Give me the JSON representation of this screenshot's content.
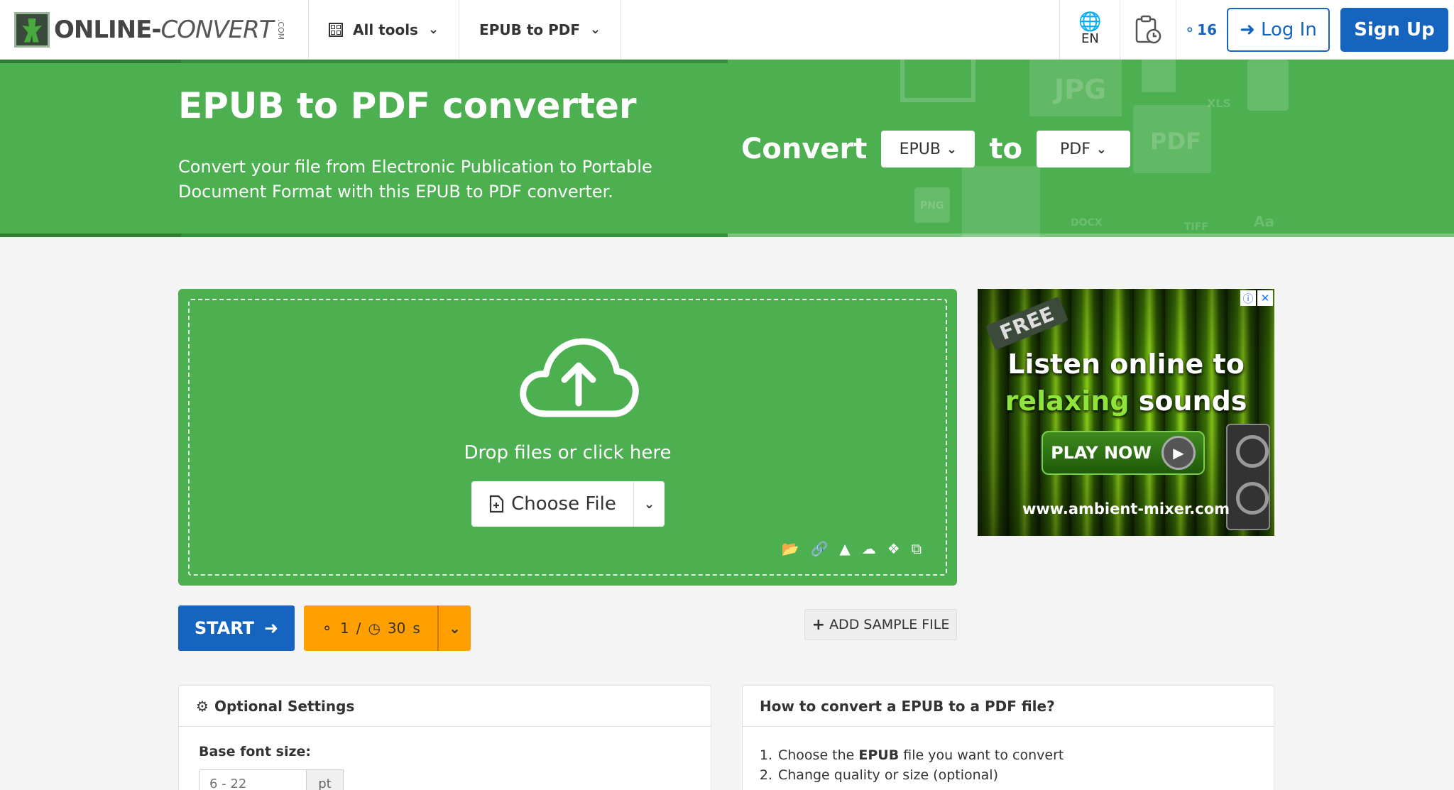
{
  "brand": {
    "name_main": "ONLINE",
    "name_dash": "-",
    "name_rest": "CONVERT",
    "name_tld": ".COM"
  },
  "nav": {
    "all_tools": "All tools",
    "current_tool": "EPUB to PDF",
    "language": "EN",
    "credits": "16",
    "login": "Log In",
    "signup": "Sign Up"
  },
  "hero": {
    "title": "EPUB to PDF converter",
    "description": "Convert your file from Electronic Publication to Portable Document Format with this EPUB to PDF converter.",
    "convert_label": "Convert",
    "from_format": "EPUB",
    "to_label": "to",
    "to_format": "PDF",
    "bg_icons": [
      "JPG",
      "PDF",
      "XLS",
      "PNG",
      "DOCX",
      "TIFF",
      "Aa"
    ]
  },
  "upload": {
    "drop_text": "Drop files or click here",
    "choose_file": "Choose File",
    "source_icons": [
      "folder-icon",
      "link-icon",
      "google-drive-icon",
      "onedrive-icon",
      "dropbox-icon",
      "clipboard-icon"
    ]
  },
  "ad": {
    "badge": "FREE",
    "line1": "Listen online to",
    "line2_green": "relaxing",
    "line2_rest": " sounds",
    "cta": "PLAY NOW",
    "url": "www.ambient-mixer.com",
    "info_glyph": "ⓘ",
    "close_glyph": "✕"
  },
  "actions": {
    "start": "START",
    "quota_credits": "1",
    "quota_sep": "/",
    "quota_time": "30",
    "quota_unit": "s",
    "add_sample": "ADD SAMPLE FILE"
  },
  "settings": {
    "title": "Optional Settings",
    "base_font_label": "Base font size:",
    "base_font_placeholder": "6 - 22",
    "base_font_unit": "pt"
  },
  "howto": {
    "title": "How to convert a EPUB to a PDF file?",
    "step1_pre": "Choose the ",
    "step1_bold": "EPUB",
    "step1_post": " file you want to convert",
    "step2": "Change quality or size (optional)"
  },
  "colors": {
    "green": "#4caf50",
    "blue": "#1565c0",
    "orange": "#ffa000"
  }
}
